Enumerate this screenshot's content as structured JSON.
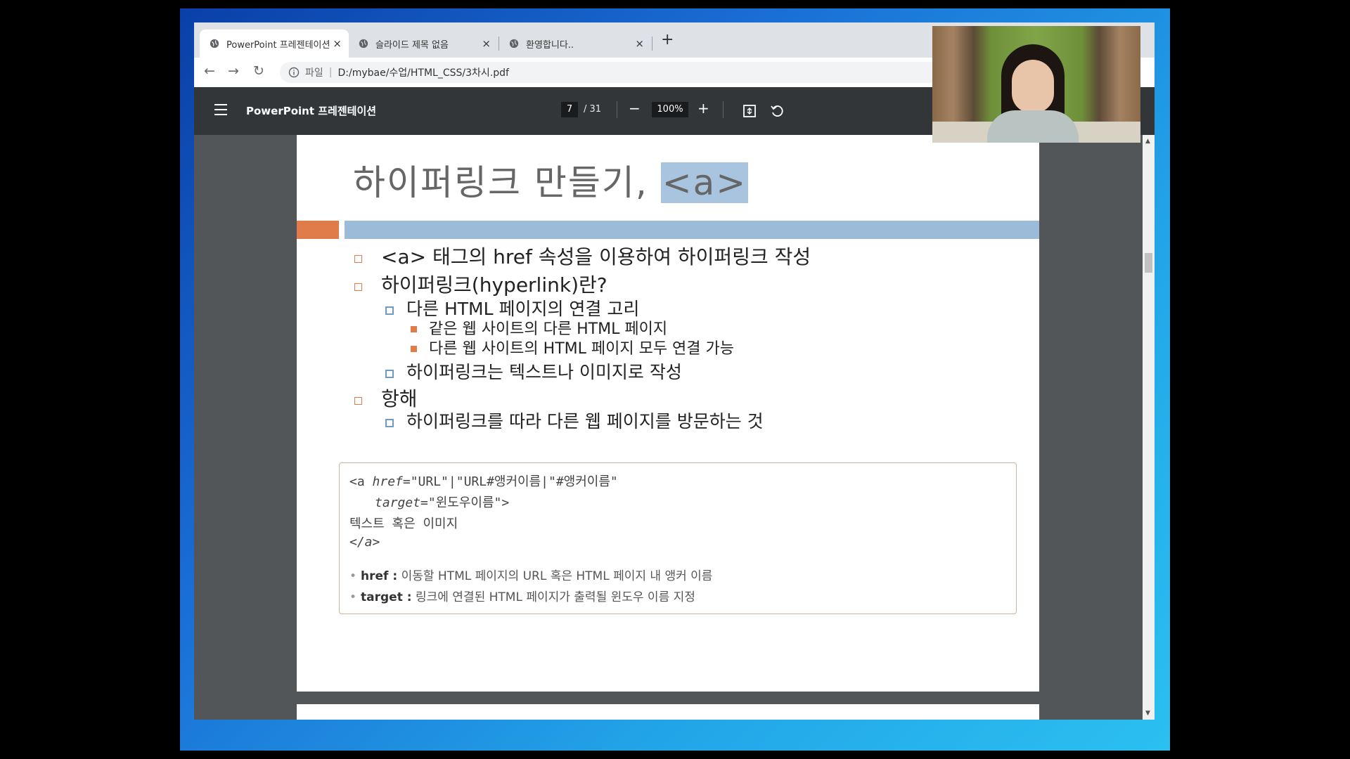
{
  "browser": {
    "tabs": [
      {
        "title": "PowerPoint 프레젠테이션",
        "active": true
      },
      {
        "title": "슬라이드 제목 없음",
        "active": false
      },
      {
        "title": "환영합니다..",
        "active": false
      }
    ],
    "close_glyph": "×",
    "new_tab_glyph": "+",
    "address": {
      "scheme_label": "파일",
      "separator": "|",
      "path": "D:/mybae/수업/HTML_CSS/3차시.pdf"
    }
  },
  "pdf_toolbar": {
    "doc_title": "PowerPoint 프레젠테이션",
    "page_current": "7",
    "page_total": "/ 31",
    "zoom": "100%",
    "zoom_out_glyph": "−",
    "zoom_in_glyph": "+"
  },
  "slide": {
    "title_main": "하이퍼링크 만들기, ",
    "title_tag": "<a>",
    "bullets": {
      "b1": "<a> 태그의 href 속성을 이용하여 하이퍼링크 작성",
      "b2": "하이퍼링크(hyperlink)란?",
      "b2_1": "다른 HTML 페이지의 연결 고리",
      "b2_1_1": "같은 웹 사이트의 다른 HTML 페이지",
      "b2_1_2": "다른 웹 사이트의 HTML 페이지 모두 연결 가능",
      "b2_2": "하이퍼링크는 텍스트나 이미지로 작성",
      "b3": "항해",
      "b3_1": "하이퍼링크를 따라 다른 웹 페이지를 방문하는 것"
    },
    "code": {
      "line1_open": "<a ",
      "line1_attr": "href",
      "line1_rest": "=\"URL\"|\"URL#앵커이름|\"#앵커이름\"",
      "line2_attr": "target",
      "line2_rest": "=\"윈도우이름\">",
      "line3": "텍스트 혹은 이미지",
      "line4": "</a>"
    },
    "desc": {
      "d1_key": "href :",
      "d1_text": " 이동할 HTML 페이지의 URL 혹은 HTML 페이지 내 앵커 이름",
      "d2_key": "target :",
      "d2_text": " 링크에 연결된 HTML 페이지가 출력될 윈도우 이름 지정",
      "dot": "•"
    }
  },
  "colors": {
    "orange": "#e07b4a",
    "blue_band": "#9bbbd8",
    "toolbar": "#323639",
    "viewer_bg": "#525659"
  },
  "icons": [
    "globe-icon",
    "back-arrow-icon",
    "forward-arrow-icon",
    "reload-icon",
    "info-icon",
    "menu-icon",
    "fit-page-icon",
    "rotate-icon"
  ]
}
